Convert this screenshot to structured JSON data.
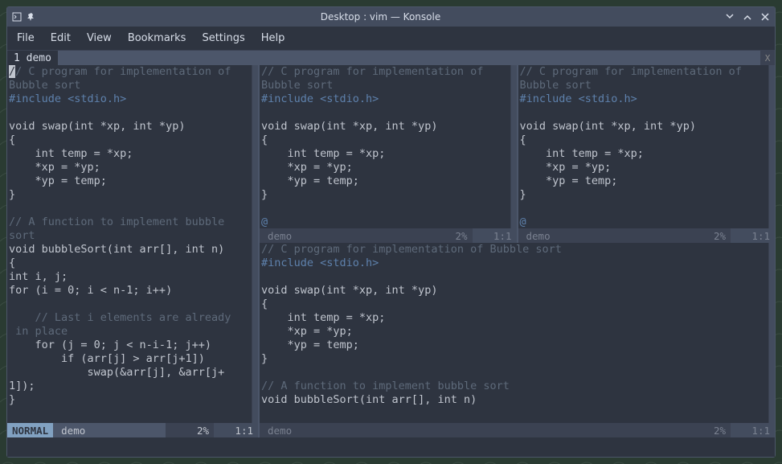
{
  "window": {
    "title": "Desktop : vim — Konsole"
  },
  "menubar": {
    "file": "File",
    "edit": "Edit",
    "view": "View",
    "bookmarks": "Bookmarks",
    "settings": "Settings",
    "help": "Help"
  },
  "tabs": {
    "active": "1 demo",
    "close": "X"
  },
  "panes": {
    "left": {
      "code": {
        "l1a": "/",
        "l1b": "/ C program for implementation of",
        "l2": "Bubble sort",
        "l3": "#include <stdio.h>",
        "l4": "",
        "l5": "void swap(int *xp, int *yp)",
        "l6": "{",
        "l7": "    int temp = *xp;",
        "l8": "    *xp = *yp;",
        "l9": "    *yp = temp;",
        "l10": "}",
        "l11": "",
        "l12": "// A function to implement bubble ",
        "l13": "sort",
        "l14": "void bubbleSort(int arr[], int n)",
        "l15": "{",
        "l16": "int i, j;",
        "l17": "for (i = 0; i < n-1; i++)",
        "l18": "",
        "l19": "    // Last i elements are already",
        "l20": " in place",
        "l21": "    for (j = 0; j < n-i-1; j++)",
        "l22": "        if (arr[j] > arr[j+1])",
        "l23": "            swap(&arr[j], &arr[j+",
        "l24": "1]);",
        "l25": "}"
      },
      "status": {
        "mode": "NORMAL",
        "file": "demo",
        "pct": "2%",
        "pos": "1:1"
      }
    },
    "topA": {
      "code": {
        "l1": "// C program for implementation of",
        "l2": "Bubble sort",
        "l3": "#include <stdio.h>",
        "l4": "",
        "l5": "void swap(int *xp, int *yp)",
        "l6": "{",
        "l7": "    int temp = *xp;",
        "l8": "    *xp = *yp;",
        "l9": "    *yp = temp;",
        "l10": "}",
        "l11": "",
        "l12": "@"
      },
      "status": {
        "file": "demo",
        "pct": "2%",
        "pos": "1:1"
      }
    },
    "topB": {
      "code": {
        "l1": "// C program for implementation of",
        "l2": "Bubble sort",
        "l3": "#include <stdio.h>",
        "l4": "",
        "l5": "void swap(int *xp, int *yp)",
        "l6": "{",
        "l7": "    int temp = *xp;",
        "l8": "    *xp = *yp;",
        "l9": "    *yp = temp;",
        "l10": "}",
        "l11": "",
        "l12": "@"
      },
      "status": {
        "file": "demo",
        "pct": "2%",
        "pos": "1:1"
      }
    },
    "bottom": {
      "code": {
        "l1": "// C program for implementation of Bubble sort",
        "l2": "#include <stdio.h>",
        "l3": "",
        "l4": "void swap(int *xp, int *yp)",
        "l5": "{",
        "l6": "    int temp = *xp;",
        "l7": "    *xp = *yp;",
        "l8": "    *yp = temp;",
        "l9": "}",
        "l10": "",
        "l11": "// A function to implement bubble sort",
        "l12": "void bubbleSort(int arr[], int n)"
      },
      "status": {
        "file": "demo",
        "pct": "2%",
        "pos": "1:1"
      }
    }
  }
}
